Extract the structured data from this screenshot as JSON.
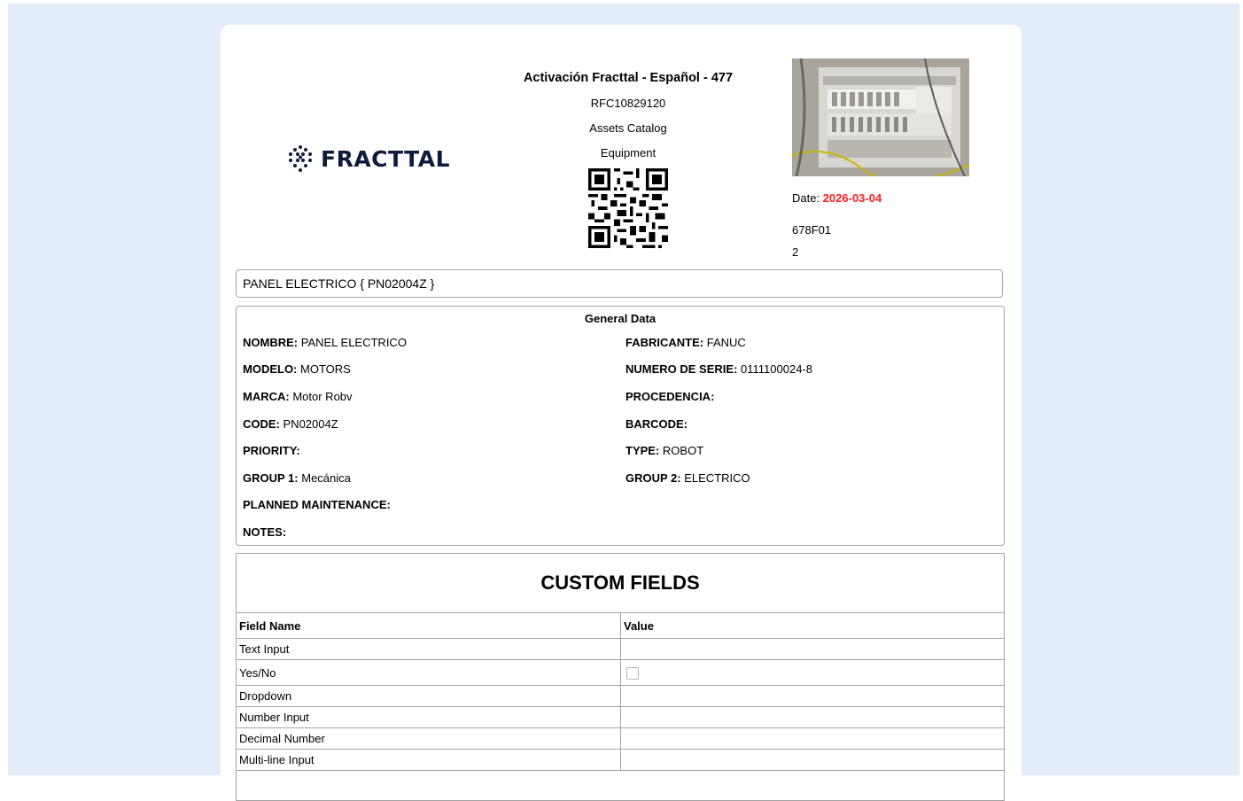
{
  "header": {
    "logo_text": "FRACTTAL",
    "title": "Activación Fracttal - Español - 477",
    "rfc": "RFC10829120",
    "catalog": "Assets Catalog",
    "category": "Equipment",
    "date_label": "Date:",
    "date_value": "2026-03-04",
    "code_line": "678F01",
    "number_line": "2"
  },
  "asset_title": "PANEL ELECTRICO { PN02004Z }",
  "general_data": {
    "title": "General Data",
    "fields": [
      {
        "label": "NOMBRE:",
        "value": "PANEL ELECTRICO"
      },
      {
        "label": "FABRICANTE:",
        "value": "FANUC"
      },
      {
        "label": "MODELO:",
        "value": "MOTORS"
      },
      {
        "label": "NUMERO DE SERIE:",
        "value": "0111100024-8"
      },
      {
        "label": "MARCA:",
        "value": "Motor Robv"
      },
      {
        "label": "PROCEDENCIA:",
        "value": ""
      },
      {
        "label": "CODE:",
        "value": "PN02004Z"
      },
      {
        "label": "BARCODE:",
        "value": ""
      },
      {
        "label": "PRIORITY:",
        "value": ""
      },
      {
        "label": "TYPE:",
        "value": "ROBOT"
      },
      {
        "label": "GROUP 1:",
        "value": "Mecánica"
      },
      {
        "label": "GROUP 2:",
        "value": "ELECTRICO"
      },
      {
        "label": "PLANNED MAINTENANCE:",
        "value": ""
      },
      {
        "label": "NOTES:",
        "value": ""
      }
    ]
  },
  "custom_fields": {
    "title": "CUSTOM FIELDS",
    "columns": [
      "Field Name",
      "Value"
    ],
    "rows": [
      {
        "name": "Text Input",
        "value": ""
      },
      {
        "name": "Yes/No",
        "value": "",
        "checked": false
      },
      {
        "name": "Dropdown",
        "value": ""
      },
      {
        "name": "Number Input",
        "value": ""
      },
      {
        "name": "Decimal Number",
        "value": ""
      },
      {
        "name": "Multi-line Input",
        "value": ""
      }
    ]
  },
  "colors": {
    "page_background": "#e3ecf9",
    "date_accent": "#ff1d1d",
    "border": "#a3a3a3",
    "logo": "#0f1b3d"
  }
}
